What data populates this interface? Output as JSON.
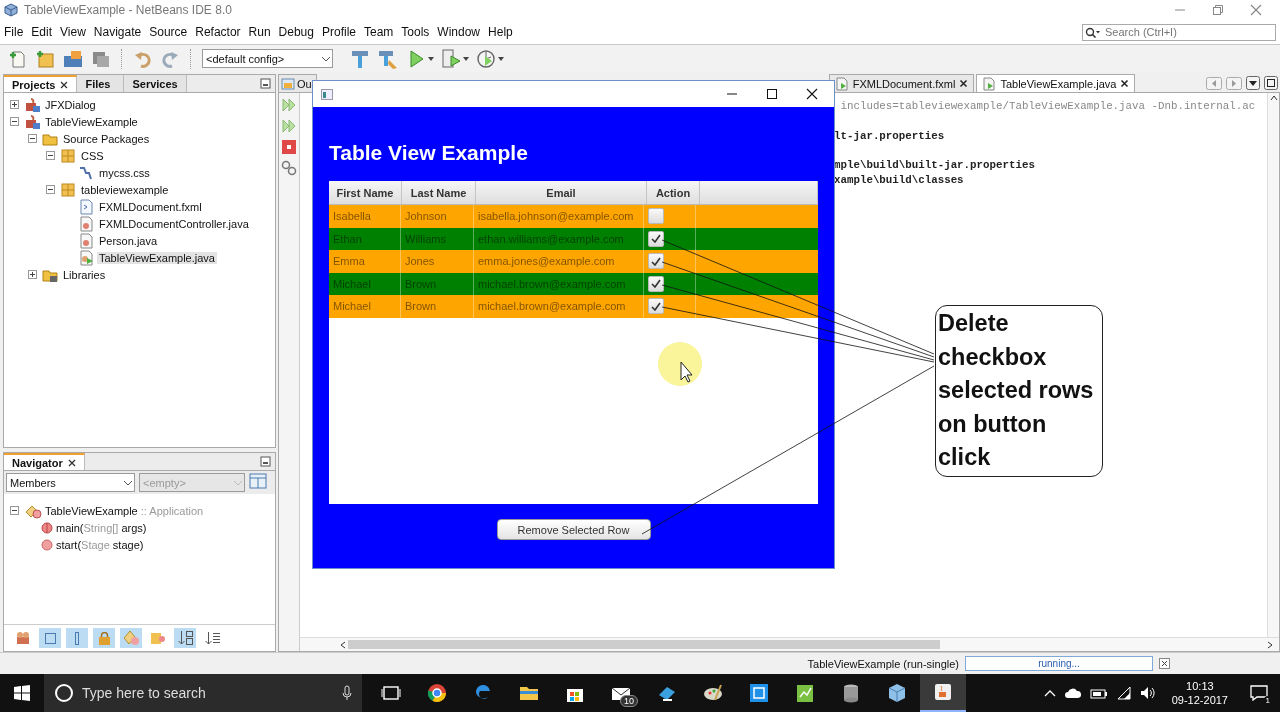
{
  "window": {
    "title": "TableViewExample - NetBeans IDE 8.0"
  },
  "menu": [
    "File",
    "Edit",
    "View",
    "Navigate",
    "Source",
    "Refactor",
    "Run",
    "Debug",
    "Profile",
    "Team",
    "Tools",
    "Window",
    "Help"
  ],
  "toolbar": {
    "config": "<default config>"
  },
  "search": {
    "placeholder": "Search (Ctrl+I)"
  },
  "projects": {
    "tabs": [
      {
        "label": "Projects",
        "selected": true,
        "closable": true
      },
      {
        "label": "Files",
        "selected": false,
        "closable": false
      },
      {
        "label": "Services",
        "selected": false,
        "closable": false
      }
    ],
    "tree": [
      {
        "label": "JFXDialog",
        "kind": "project",
        "expanded": false,
        "selected": false
      },
      {
        "label": "TableViewExample",
        "kind": "project",
        "expanded": true,
        "selected": false,
        "children": [
          {
            "label": "Source Packages",
            "kind": "folder",
            "expanded": true,
            "selected": false,
            "children": [
              {
                "label": "CSS",
                "kind": "package",
                "expanded": true,
                "selected": false,
                "children": [
                  {
                    "label": "mycss.css",
                    "kind": "css",
                    "selected": false
                  }
                ]
              },
              {
                "label": "tableviewexample",
                "kind": "package",
                "expanded": true,
                "selected": false,
                "children": [
                  {
                    "label": "FXMLDocument.fxml",
                    "kind": "fxml",
                    "selected": false
                  },
                  {
                    "label": "FXMLDocumentController.java",
                    "kind": "java",
                    "selected": false
                  },
                  {
                    "label": "Person.java",
                    "kind": "java",
                    "selected": false
                  },
                  {
                    "label": "TableViewExample.java",
                    "kind": "main",
                    "selected": true
                  }
                ]
              }
            ]
          },
          {
            "label": "Libraries",
            "kind": "library",
            "expanded": false,
            "selected": false
          }
        ]
      }
    ]
  },
  "navigator": {
    "title": "Navigator",
    "view": "Members",
    "filter": "<empty>",
    "root": {
      "expanded": true,
      "parts": [
        {
          "text": "TableViewExample",
          "muted": false
        },
        {
          "text": " :: Application",
          "muted": true
        }
      ],
      "children": [
        {
          "kind": "static-method",
          "parts": [
            {
              "text": "main(",
              "muted": false
            },
            {
              "text": "String[]",
              "muted": true
            },
            {
              "text": " args)",
              "muted": false
            }
          ]
        },
        {
          "kind": "method",
          "parts": [
            {
              "text": "start(",
              "muted": false
            },
            {
              "text": "Stage",
              "muted": true
            },
            {
              "text": " stage)",
              "muted": false
            }
          ]
        }
      ]
    },
    "tools": [
      {
        "kind": "hierarchy",
        "on": false
      },
      {
        "kind": "fields",
        "on": true
      },
      {
        "kind": "bar",
        "on": true
      },
      {
        "kind": "lock",
        "on": true
      },
      {
        "kind": "shapes",
        "on": true
      },
      {
        "kind": "inherited",
        "on": false
      },
      {
        "kind": "sort-a",
        "on": true
      },
      {
        "kind": "sort-b",
        "on": false
      }
    ]
  },
  "output": {
    "tabs": [
      {
        "label": "Ou",
        "selected": false,
        "closable": false
      },
      {
        "label": "FXMLDocument.fxml",
        "selected": false,
        "closable": true
      },
      {
        "label": "TableViewExample.java",
        "selected": true,
        "closable": true
      }
    ],
    "lines": [
      {
        "text": " includes=tableviewexample/TableViewExample.java -Dnb.internal.ac",
        "muted": true
      },
      {
        "text": "lt-jar.properties",
        "muted": false
      },
      {
        "text": "mple\\build\\built-jar.properties",
        "muted": false
      },
      {
        "text": "xample\\build\\classes",
        "muted": false
      }
    ]
  },
  "app_window": {
    "heading": "Table View Example",
    "columns": [
      "First Name",
      "Last Name",
      "Email",
      "Action"
    ],
    "rows": [
      {
        "first": "Isabella",
        "last": "Johnson",
        "email": "isabella.johnson@example.com",
        "checked": false,
        "color": "#ffa500"
      },
      {
        "first": "Ethan",
        "last": "Williams",
        "email": "ethan.williams@example.com",
        "checked": true,
        "color": "#008000"
      },
      {
        "first": "Emma",
        "last": "Jones",
        "email": "emma.jones@example.com",
        "checked": true,
        "color": "#ffa500"
      },
      {
        "first": "Michael",
        "last": "Brown",
        "email": "michael.brown@example.com",
        "checked": true,
        "color": "#008000"
      },
      {
        "first": "Michael",
        "last": "Brown",
        "email": "michael.brown@example.com",
        "checked": true,
        "color": "#ffa500"
      }
    ],
    "button": "Remove Selected Row"
  },
  "callout": {
    "text": "Delete checkbox selected rows on button click"
  },
  "status_bar": {
    "task": "TableViewExample (run-single)",
    "progress": "running..."
  },
  "taskbar": {
    "search_placeholder": "Type here to search",
    "apps": [
      {
        "kind": "task-view",
        "active": false
      },
      {
        "kind": "chrome",
        "active": false
      },
      {
        "kind": "edge",
        "active": false
      },
      {
        "kind": "explorer",
        "active": false
      },
      {
        "kind": "store",
        "active": false
      },
      {
        "kind": "mail",
        "active": false,
        "badge": "10"
      },
      {
        "kind": "monitor",
        "active": false
      },
      {
        "kind": "paint",
        "active": false
      },
      {
        "kind": "snip",
        "active": false
      },
      {
        "kind": "notepad",
        "active": false
      },
      {
        "kind": "database",
        "active": false
      },
      {
        "kind": "cube",
        "active": false
      },
      {
        "kind": "java",
        "active": true
      }
    ],
    "time": "10:13",
    "date": "09-12-2017",
    "notifications": "1"
  }
}
